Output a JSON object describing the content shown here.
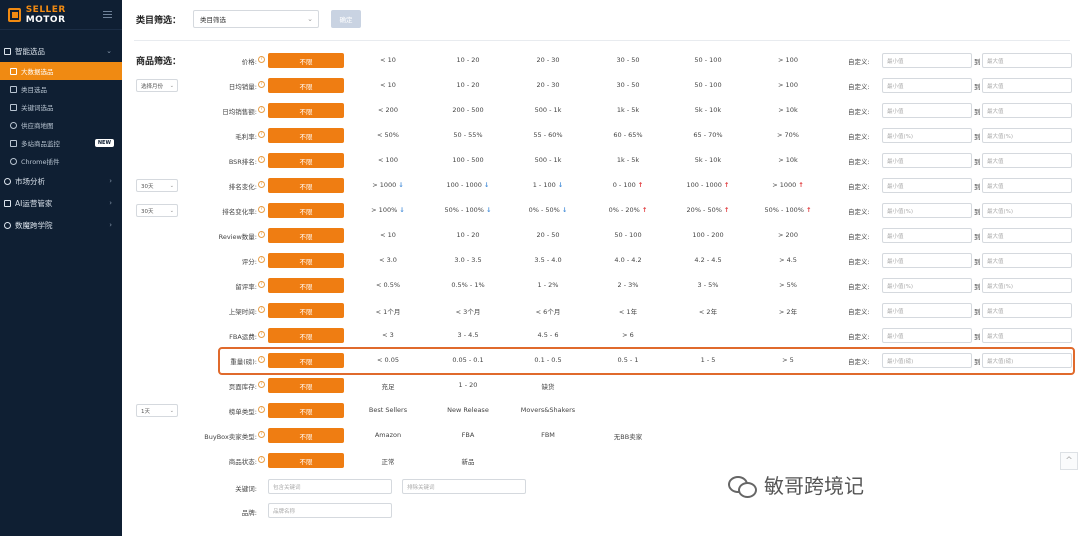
{
  "brand": {
    "name_a": "SELLER",
    "name_b": "MOTOR"
  },
  "colors": {
    "accent": "#ef7d12",
    "sidebar": "#0f1f33",
    "highlight": "#e06a2c"
  },
  "sidebar": {
    "groups": [
      {
        "label": "智能选品",
        "items": [
          {
            "label": "大数据选品",
            "icon": "trend-icon",
            "active": true
          },
          {
            "label": "类目选品",
            "icon": "category-icon"
          },
          {
            "label": "关键词选品",
            "icon": "keyword-icon"
          },
          {
            "label": "供应商地图",
            "icon": "supplier-icon"
          },
          {
            "label": "多站商品监控",
            "icon": "monitor-icon",
            "badge": "NEW"
          },
          {
            "label": "Chrome插件",
            "icon": "chrome-icon"
          }
        ]
      },
      {
        "label": "市场分析"
      },
      {
        "label": "AI运营管家"
      },
      {
        "label": "数魔跨学院"
      }
    ]
  },
  "category": {
    "title": "类目筛选：",
    "select_value": "类目筛选",
    "confirm": "确定"
  },
  "goods_title": "商品筛选：",
  "custom_label": "自定义:",
  "to_label": "到",
  "rows": [
    {
      "label": "价格:",
      "pill": "不限",
      "opts": [
        "< 10",
        "10 - 20",
        "20 - 30",
        "30 - 50",
        "50 - 100",
        "> 100"
      ],
      "min": "最小值",
      "max": "最大值"
    },
    {
      "label": "日均销量:",
      "select": "选择月份",
      "pill": "不限",
      "opts": [
        "< 10",
        "10 - 20",
        "20 - 30",
        "30 - 50",
        "50 - 100",
        "> 100"
      ],
      "min": "最小值",
      "max": "最大值"
    },
    {
      "label": "日均销售额:",
      "pill": "不限",
      "opts": [
        "< 200",
        "200 - 500",
        "500 - 1k",
        "1k - 5k",
        "5k - 10k",
        "> 10k"
      ],
      "min": "最小值",
      "max": "最大值"
    },
    {
      "label": "毛利率:",
      "pill": "不限",
      "opts": [
        "< 50%",
        "50 - 55%",
        "55 - 60%",
        "60 - 65%",
        "65 - 70%",
        "> 70%"
      ],
      "min": "最小值(%)",
      "max": "最大值(%)"
    },
    {
      "label": "BSR排名:",
      "pill": "不限",
      "opts": [
        "< 100",
        "100 - 500",
        "500 - 1k",
        "1k - 5k",
        "5k - 10k",
        "> 10k"
      ],
      "min": "最小值",
      "max": "最大值"
    },
    {
      "label": "排名变化:",
      "select": "30天",
      "pill": "不限",
      "opts": [
        "> 1000",
        "100 - 1000",
        "1 - 100",
        "0 - 100",
        "100 - 1000",
        "> 1000"
      ],
      "dirs": [
        "down",
        "down",
        "down",
        "up",
        "up",
        "up"
      ],
      "min": "最小值",
      "max": "最大值"
    },
    {
      "label": "排名变化率:",
      "select": "30天",
      "pill": "不限",
      "opts": [
        "> 100%",
        "50% - 100%",
        "0% - 50%",
        "0% - 20%",
        "20% - 50%",
        "50% - 100%"
      ],
      "dirs": [
        "down",
        "down",
        "down",
        "up",
        "up",
        "up"
      ],
      "min": "最小值(%)",
      "max": "最大值(%)"
    },
    {
      "label": "Review数量:",
      "pill": "不限",
      "opts": [
        "< 10",
        "10 - 20",
        "20 - 50",
        "50 - 100",
        "100 - 200",
        "> 200"
      ],
      "min": "最小值",
      "max": "最大值"
    },
    {
      "label": "评分:",
      "pill": "不限",
      "opts": [
        "< 3.0",
        "3.0 - 3.5",
        "3.5 - 4.0",
        "4.0 - 4.2",
        "4.2 - 4.5",
        "> 4.5"
      ],
      "min": "最小值",
      "max": "最大值"
    },
    {
      "label": "留评率:",
      "pill": "不限",
      "opts": [
        "< 0.5%",
        "0.5% - 1%",
        "1 - 2%",
        "2 - 3%",
        "3 - 5%",
        "> 5%"
      ],
      "min": "最小值(%)",
      "max": "最大值(%)"
    },
    {
      "label": "上架时间:",
      "pill": "不限",
      "opts": [
        "< 1个月",
        "< 3个月",
        "< 6个月",
        "< 1年",
        "< 2年",
        "> 2年"
      ],
      "min": "最小值",
      "max": "最大值"
    },
    {
      "label": "FBA运费:",
      "pill": "不限",
      "opts": [
        "< 3",
        "3 - 4.5",
        "4.5 - 6",
        "> 6"
      ],
      "min": "最小值",
      "max": "最大值"
    },
    {
      "label": "重量(磅):",
      "pill": "不限",
      "opts": [
        "< 0.05",
        "0.05 - 0.1",
        "0.1 - 0.5",
        "0.5 - 1",
        "1 - 5",
        "> 5"
      ],
      "min": "最小值(磅)",
      "max": "最大值(磅)"
    },
    {
      "label": "页面库存:",
      "pill": "不限",
      "opts": [
        "充足",
        "1 - 20",
        "缺货"
      ]
    },
    {
      "label": "榜单类型:",
      "select": "1天",
      "pill": "不限",
      "opts": [
        "Best Sellers",
        "New Release",
        "Movers&Shakers"
      ]
    },
    {
      "label": "BuyBox卖家类型:",
      "pill": "不限",
      "opts": [
        "Amazon",
        "FBA",
        "FBM",
        "无BB卖家"
      ]
    },
    {
      "label": "商品状态:",
      "pill": "不限",
      "opts": [
        "正常",
        "新品"
      ]
    }
  ],
  "keyword": {
    "label": "关键词:",
    "include": "包含关键词",
    "exclude": "排除关键词"
  },
  "brand_filter": {
    "label": "品牌:",
    "placeholder": "品牌名称"
  },
  "scroll_top": "^",
  "watermark": "敏哥跨境记"
}
